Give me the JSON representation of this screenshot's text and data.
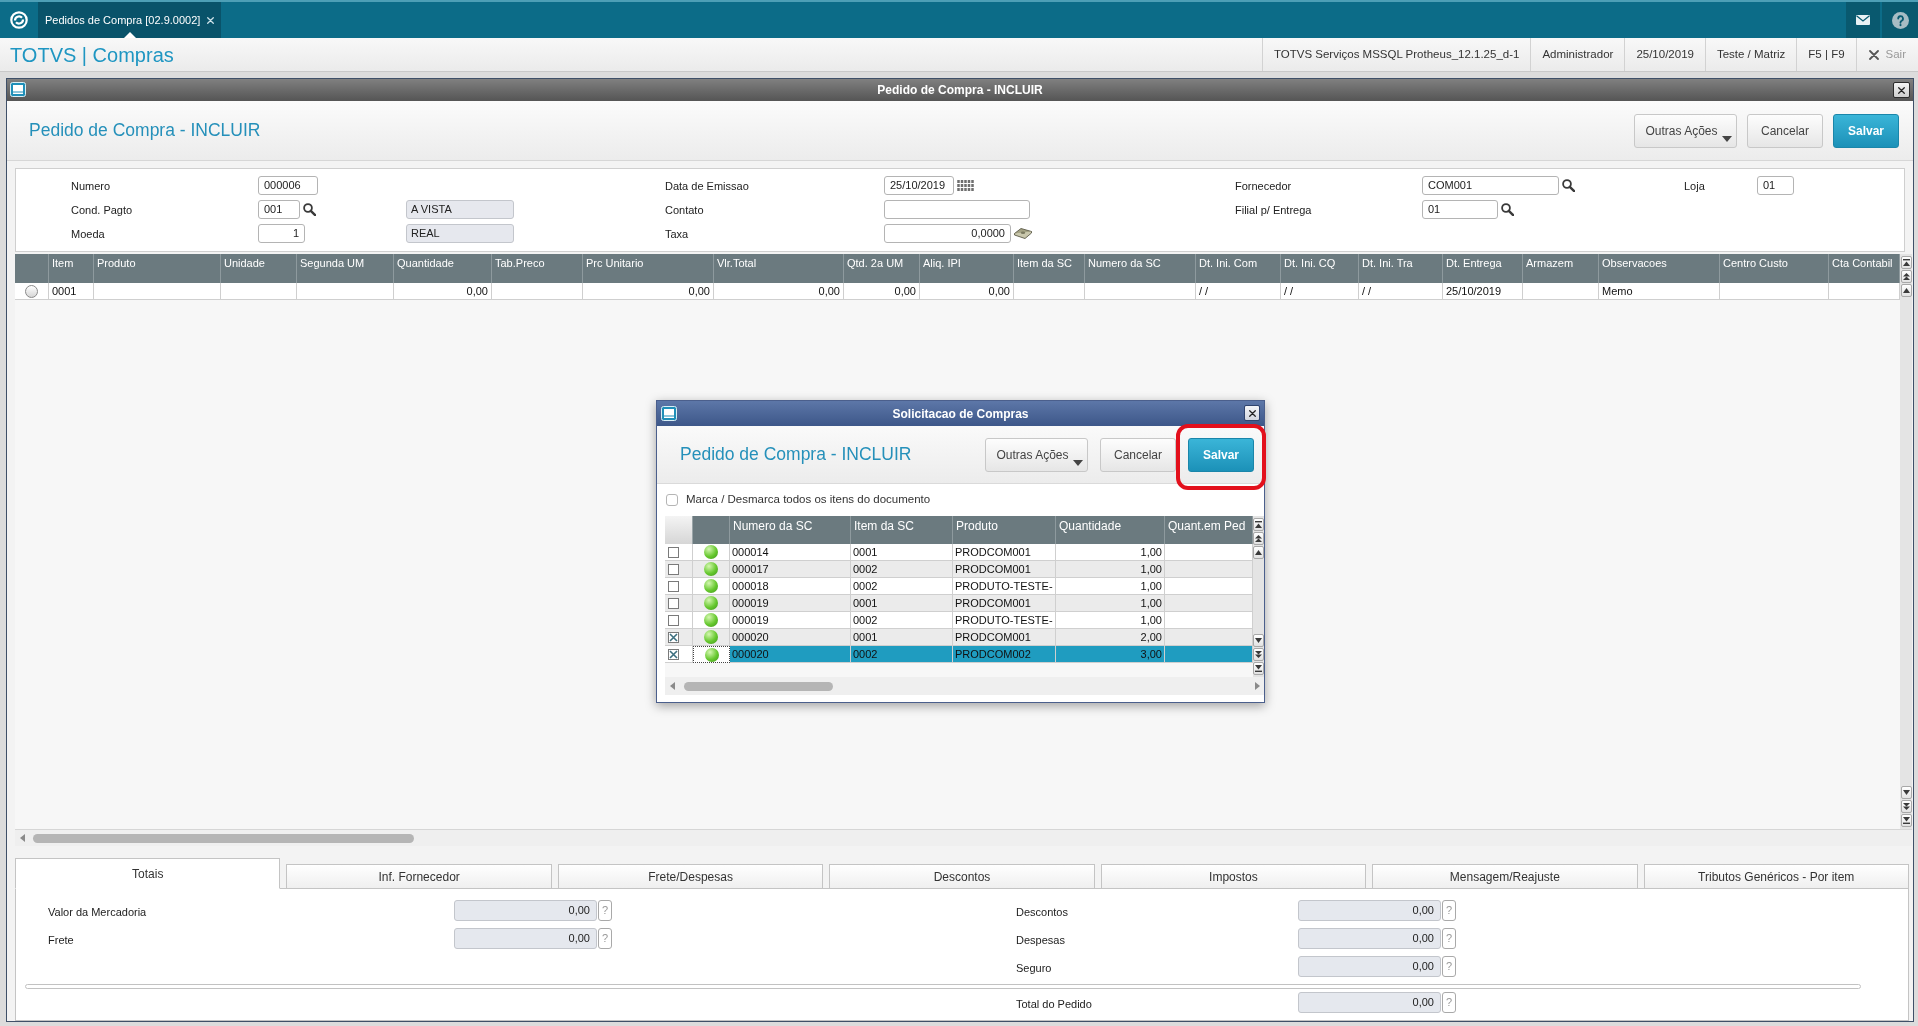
{
  "top_bar": {
    "tabs": [
      {
        "label": "Pedidos de Compra [02.9.0002]",
        "selected": true
      }
    ]
  },
  "app_bar": {
    "title": "TOTVS | Compras",
    "status_items": [
      "TOTVS Serviços MSSQL Protheus_12.1.25_d-1",
      "Administrador",
      "25/10/2019",
      "Teste / Matriz",
      "F5 | F9"
    ],
    "exit_label": "Sair"
  },
  "window": {
    "title": "Pedido de Compra - INCLUIR",
    "heading": "Pedido de Compra - INCLUIR",
    "buttons": [
      {
        "label": "Outras Ações",
        "kind": "menu"
      },
      {
        "label": "Cancelar",
        "kind": "cancel"
      },
      {
        "label": "Salvar",
        "kind": "confirm"
      }
    ]
  },
  "form": {
    "rows": [
      [
        {
          "label": "Numero",
          "value": "000006",
          "kind": "text"
        },
        {
          "label": "Data de Emissao",
          "value": "25/10/2019",
          "kind": "date"
        },
        {
          "label": "Fornecedor",
          "value": "COM001",
          "kind": "lookup"
        },
        {
          "label": "Loja",
          "value": "01",
          "kind": "text"
        }
      ],
      [
        {
          "label": "Cond. Pagto",
          "value": "001",
          "kind": "lookup",
          "description": "A VISTA"
        },
        {
          "label": "Contato",
          "kind": "text"
        },
        {
          "label": "Filial p/ Entrega",
          "value": "01",
          "kind": "lookup"
        }
      ],
      [
        {
          "label": "Moeda",
          "value": "1",
          "kind": "number",
          "description": "REAL"
        },
        {
          "label": "Taxa",
          "value": "0,0000",
          "kind": "rate"
        }
      ]
    ]
  },
  "items_grid": {
    "columns": [
      {
        "label": "Item",
        "kind": "text"
      },
      {
        "label": "Produto",
        "kind": "text"
      },
      {
        "label": "Unidade",
        "kind": "text"
      },
      {
        "label": "Segunda UM",
        "kind": "text"
      },
      {
        "label": "Quantidade",
        "kind": "number"
      },
      {
        "label": "Tab.Preco",
        "kind": "text"
      },
      {
        "label": "Prc Unitario",
        "kind": "number"
      },
      {
        "label": "Vlr.Total",
        "kind": "number"
      },
      {
        "label": "Qtd. 2a UM",
        "kind": "number"
      },
      {
        "label": "Aliq. IPI",
        "kind": "number"
      },
      {
        "label": "Item da SC",
        "kind": "text"
      },
      {
        "label": "Numero da SC",
        "kind": "text"
      },
      {
        "label": "Dt. Ini. Com",
        "kind": "text"
      },
      {
        "label": "Dt. Ini. CQ",
        "kind": "text"
      },
      {
        "label": "Dt. Ini. Tra",
        "kind": "text"
      },
      {
        "label": "Dt. Entrega",
        "kind": "text"
      },
      {
        "label": "Armazem",
        "kind": "text"
      },
      {
        "label": "Observacoes",
        "kind": "text"
      },
      {
        "label": "Centro Custo",
        "kind": "text"
      },
      {
        "label": "Cta Contabil",
        "kind": "text"
      }
    ],
    "rows": [
      {
        "selected": false,
        "cells": [
          "0001",
          null,
          null,
          null,
          "0,00",
          null,
          "0,00",
          "0,00",
          "0,00",
          "0,00",
          null,
          null,
          "/ /",
          "/ /",
          "/ /",
          "25/10/2019",
          null,
          "Memo",
          null,
          null
        ]
      }
    ]
  },
  "dialog": {
    "title": "Solicitacao de Compras",
    "heading": "Pedido de Compra - INCLUIR",
    "buttons": [
      {
        "label": "Outras Ações",
        "kind": "menu",
        "highlighted": false
      },
      {
        "label": "Cancelar",
        "kind": "cancel",
        "highlighted": false
      },
      {
        "label": "Salvar",
        "kind": "confirm",
        "highlighted": true
      }
    ],
    "select_all": {
      "label": "Marca / Desmarca todos os itens do documento",
      "checked": false
    },
    "grid": {
      "columns": [
        {
          "label": "Numero da SC",
          "kind": "text"
        },
        {
          "label": "Item da SC",
          "kind": "text"
        },
        {
          "label": "Produto",
          "kind": "text"
        },
        {
          "label": "Quantidade",
          "kind": "number"
        },
        {
          "label": "Quant.em Ped",
          "kind": "number"
        }
      ],
      "rows": [
        {
          "checked": false,
          "selected": false,
          "cells": [
            "000014",
            "0001",
            "PRODCOM001",
            "1,00",
            null
          ]
        },
        {
          "checked": false,
          "selected": false,
          "cells": [
            "000017",
            "0002",
            "PRODCOM001",
            "1,00",
            null
          ]
        },
        {
          "checked": false,
          "selected": false,
          "cells": [
            "000018",
            "0002",
            "PRODUTO-TESTE-",
            "1,00",
            null
          ]
        },
        {
          "checked": false,
          "selected": false,
          "cells": [
            "000019",
            "0001",
            "PRODCOM001",
            "1,00",
            null
          ]
        },
        {
          "checked": false,
          "selected": false,
          "cells": [
            "000019",
            "0002",
            "PRODUTO-TESTE-",
            "1,00",
            null
          ]
        },
        {
          "checked": true,
          "selected": false,
          "cells": [
            "000020",
            "0001",
            "PRODCOM001",
            "2,00",
            null
          ]
        },
        {
          "checked": true,
          "selected": true,
          "cells": [
            "000020",
            "0002",
            "PRODCOM002",
            "3,00",
            null
          ]
        }
      ]
    }
  },
  "bottom_tabs": [
    {
      "label": "Totais",
      "selected": true
    },
    {
      "label": "Inf. Fornecedor",
      "selected": false
    },
    {
      "label": "Frete/Despesas",
      "selected": false
    },
    {
      "label": "Descontos",
      "selected": false
    },
    {
      "label": "Impostos",
      "selected": false
    },
    {
      "label": "Mensagem/Reajuste",
      "selected": false
    },
    {
      "label": "Tributos Genéricos - Por item",
      "selected": false
    }
  ],
  "totals": {
    "left": [
      {
        "label": "Valor da Mercadoria",
        "value": "0,00",
        "help": "?"
      },
      {
        "label": "Frete",
        "value": "0,00",
        "help": "?"
      }
    ],
    "right": [
      {
        "label": "Descontos",
        "value": "0,00",
        "help": "?"
      },
      {
        "label": "Despesas",
        "value": "0,00",
        "help": "?"
      },
      {
        "label": "Seguro",
        "value": "0,00",
        "help": "?"
      }
    ],
    "total": {
      "label": "Total do Pedido",
      "value": "0,00",
      "help": "?"
    }
  }
}
